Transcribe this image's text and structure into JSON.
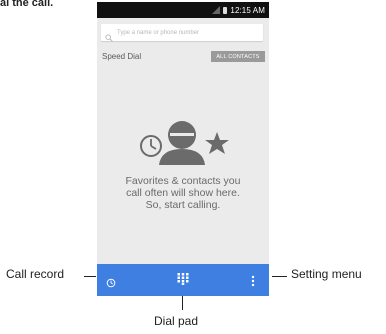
{
  "caption": "al the call.",
  "status_bar": {
    "time": "12:15 AM"
  },
  "search": {
    "placeholder": "Type a name or phone number"
  },
  "speed_dial": {
    "title": "Speed Dial",
    "all_contacts_label": "ALL CONTACTS"
  },
  "empty_state": {
    "line1": "Favorites & contacts you",
    "line2": "call often will show here.",
    "line3": "So, start calling."
  },
  "bottom_bar": {
    "icons": [
      "clock-icon",
      "dialpad-icon",
      "overflow-menu-icon"
    ],
    "accent": "#3f7fe2"
  },
  "callouts": {
    "call_record": "Call record",
    "dial_pad": "Dial pad",
    "setting_menu": "Setting menu"
  },
  "colors": {
    "screen_bg": "#ebebeb",
    "status_bar": "#111111",
    "empty_art": "#6b6b6b",
    "chip": "#9a9a9a"
  }
}
